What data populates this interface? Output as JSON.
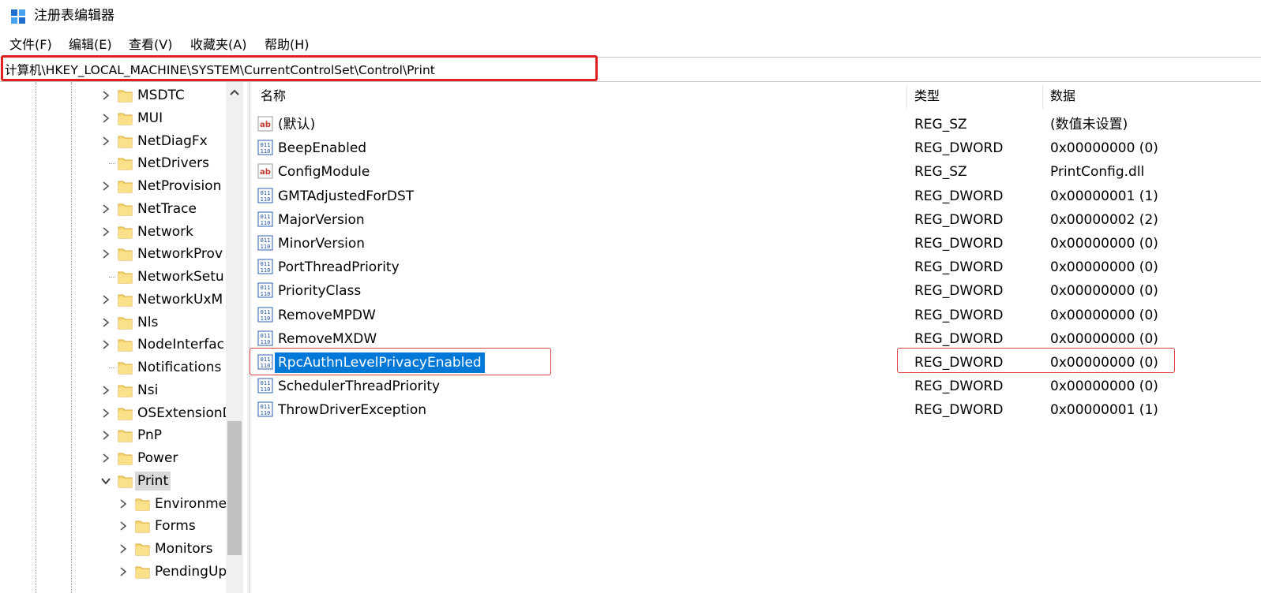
{
  "window": {
    "title": "注册表编辑器",
    "app_icon": "regedit-icon"
  },
  "menu": [
    {
      "label": "文件(F)"
    },
    {
      "label": "编辑(E)"
    },
    {
      "label": "查看(V)"
    },
    {
      "label": "收藏夹(A)"
    },
    {
      "label": "帮助(H)"
    }
  ],
  "address": {
    "path": "计算机\\HKEY_LOCAL_MACHINE\\SYSTEM\\CurrentControlSet\\Control\\Print"
  },
  "tree": {
    "items": [
      {
        "label": "MSDTC",
        "expander": "collapsed"
      },
      {
        "label": "MUI",
        "expander": "collapsed"
      },
      {
        "label": "NetDiagFx",
        "expander": "collapsed"
      },
      {
        "label": "NetDrivers",
        "expander": "none"
      },
      {
        "label": "NetProvision",
        "expander": "collapsed"
      },
      {
        "label": "NetTrace",
        "expander": "collapsed"
      },
      {
        "label": "Network",
        "expander": "collapsed"
      },
      {
        "label": "NetworkProv",
        "expander": "collapsed"
      },
      {
        "label": "NetworkSetu",
        "expander": "none"
      },
      {
        "label": "NetworkUxM",
        "expander": "collapsed"
      },
      {
        "label": "Nls",
        "expander": "collapsed"
      },
      {
        "label": "NodeInterfac",
        "expander": "collapsed"
      },
      {
        "label": "Notifications",
        "expander": "none"
      },
      {
        "label": "Nsi",
        "expander": "collapsed"
      },
      {
        "label": "OSExtensionD",
        "expander": "collapsed"
      },
      {
        "label": "PnP",
        "expander": "collapsed"
      },
      {
        "label": "Power",
        "expander": "collapsed"
      },
      {
        "label": "Print",
        "expander": "expanded",
        "selected": true
      },
      {
        "label": "Environme",
        "expander": "collapsed",
        "child": true
      },
      {
        "label": "Forms",
        "expander": "collapsed",
        "child": true
      },
      {
        "label": "Monitors",
        "expander": "collapsed",
        "child": true
      },
      {
        "label": "PendingUp",
        "expander": "collapsed",
        "child": true
      }
    ]
  },
  "list": {
    "columns": {
      "name": "名称",
      "type": "类型",
      "data": "数据"
    },
    "rows": [
      {
        "icon": "string-value-icon",
        "name": "(默认)",
        "type": "REG_SZ",
        "data": "(数值未设置)"
      },
      {
        "icon": "dword-value-icon",
        "name": "BeepEnabled",
        "type": "REG_DWORD",
        "data": "0x00000000 (0)"
      },
      {
        "icon": "string-value-icon",
        "name": "ConfigModule",
        "type": "REG_SZ",
        "data": "PrintConfig.dll"
      },
      {
        "icon": "dword-value-icon",
        "name": "GMTAdjustedForDST",
        "type": "REG_DWORD",
        "data": "0x00000001 (1)"
      },
      {
        "icon": "dword-value-icon",
        "name": "MajorVersion",
        "type": "REG_DWORD",
        "data": "0x00000002 (2)"
      },
      {
        "icon": "dword-value-icon",
        "name": "MinorVersion",
        "type": "REG_DWORD",
        "data": "0x00000000 (0)"
      },
      {
        "icon": "dword-value-icon",
        "name": "PortThreadPriority",
        "type": "REG_DWORD",
        "data": "0x00000000 (0)"
      },
      {
        "icon": "dword-value-icon",
        "name": "PriorityClass",
        "type": "REG_DWORD",
        "data": "0x00000000 (0)"
      },
      {
        "icon": "dword-value-icon",
        "name": "RemoveMPDW",
        "type": "REG_DWORD",
        "data": "0x00000000 (0)"
      },
      {
        "icon": "dword-value-icon",
        "name": "RemoveMXDW",
        "type": "REG_DWORD",
        "data": "0x00000000 (0)"
      },
      {
        "icon": "dword-value-icon",
        "name": "RpcAuthnLevelPrivacyEnabled",
        "type": "REG_DWORD",
        "data": "0x00000000 (0)",
        "selected": true
      },
      {
        "icon": "dword-value-icon",
        "name": "SchedulerThreadPriority",
        "type": "REG_DWORD",
        "data": "0x00000000 (0)"
      },
      {
        "icon": "dword-value-icon",
        "name": "ThrowDriverException",
        "type": "REG_DWORD",
        "data": "0x00000001 (1)"
      }
    ]
  },
  "colors": {
    "selection": "#0078d7",
    "annotation_red": "#e02020",
    "folder_yellow": "#f8d775"
  }
}
